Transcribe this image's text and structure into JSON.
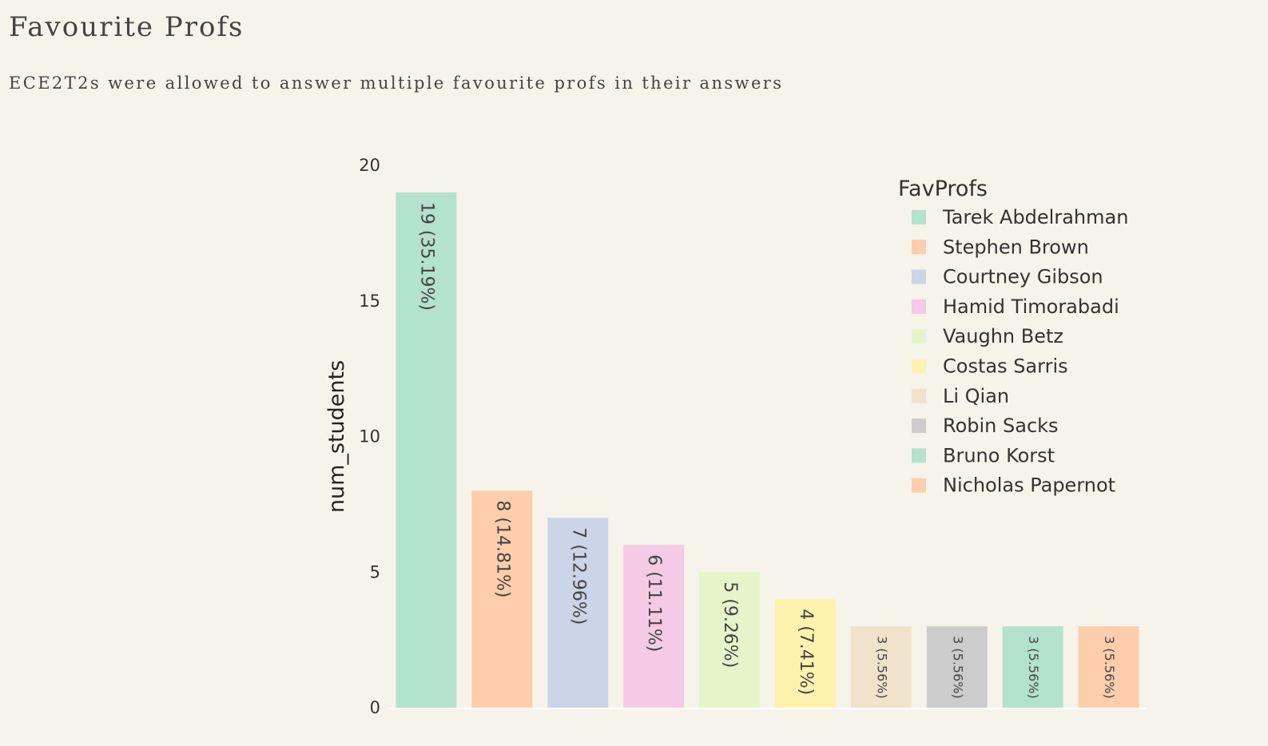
{
  "page": {
    "title": "Favourite Profs",
    "subtitle": "ECE2T2s were allowed to answer multiple favourite profs in their answers"
  },
  "chart_data": {
    "type": "bar",
    "categories": [
      "Tarek Abdelrahman",
      "Stephen Brown",
      "Courtney Gibson",
      "Hamid Timorabadi",
      "Vaughn Betz",
      "Costas Sarris",
      "Li Qian",
      "Robin Sacks",
      "Bruno Korst",
      "Nicholas Papernot"
    ],
    "values": [
      19,
      8,
      7,
      6,
      5,
      4,
      3,
      3,
      3,
      3
    ],
    "data_labels": [
      "19 (35.19%)",
      "8 (14.81%)",
      "7 (12.96%)",
      "6 (11.11%)",
      "5 (9.26%)",
      "4 (7.41%)",
      "3 (5.56%)",
      "3 (5.56%)",
      "3 (5.56%)",
      "3 (5.56%)"
    ],
    "colors": [
      "#b3e2cd",
      "#fdcdac",
      "#cbd5e8",
      "#f4cae4",
      "#e6f5c9",
      "#fff2ae",
      "#f1e2cc",
      "#cccccc",
      "#b3e2cd",
      "#fdcdac"
    ],
    "xlabel": "",
    "ylabel": "num_students",
    "ylim": [
      0,
      20
    ],
    "yticks": [
      0,
      5,
      10,
      15,
      20
    ],
    "grid": false,
    "legend": {
      "title": "FavProfs",
      "placement": "top-right"
    }
  }
}
